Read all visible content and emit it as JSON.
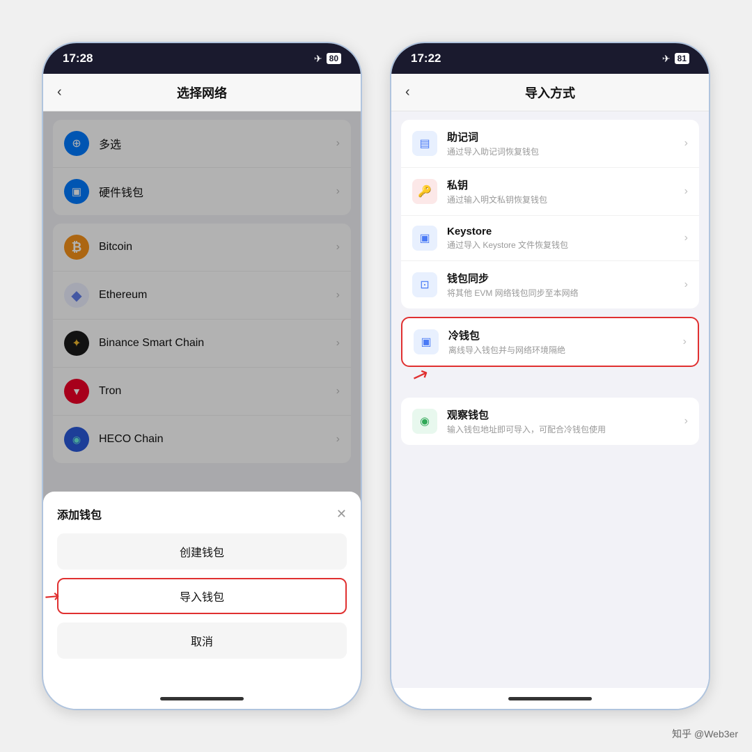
{
  "phone_left": {
    "status_time": "17:28",
    "battery": "80",
    "nav_title": "选择网络",
    "networks": [
      {
        "name": "多选",
        "icon_type": "multiselect",
        "icon_char": "⊕"
      },
      {
        "name": "硬件钱包",
        "icon_type": "hardware",
        "icon_char": "▣"
      },
      {
        "name": "Bitcoin",
        "icon_type": "btc",
        "icon_char": "₿"
      },
      {
        "name": "Ethereum",
        "icon_type": "eth",
        "icon_char": "◆"
      },
      {
        "name": "Binance Smart Chain",
        "icon_type": "bsc",
        "icon_char": "✦"
      },
      {
        "name": "Tron",
        "icon_type": "trx",
        "icon_char": "▼"
      },
      {
        "name": "HECO Chain",
        "icon_type": "heco",
        "icon_char": "◉"
      }
    ],
    "sheet_title": "添加钱包",
    "sheet_create": "创建钱包",
    "sheet_import": "导入钱包",
    "sheet_cancel": "取消"
  },
  "phone_right": {
    "status_time": "17:22",
    "battery": "81",
    "nav_title": "导入方式",
    "import_items": [
      {
        "title": "助记词",
        "desc": "通过导入助记词恢复钱包",
        "icon_char": "▤",
        "highlighted": false
      },
      {
        "title": "私钥",
        "desc": "通过输入明文私钥恢复钱包",
        "icon_char": "🔑",
        "highlighted": false
      },
      {
        "title": "Keystore",
        "desc": "通过导入 Keystore 文件恢复钱包",
        "icon_char": "▣",
        "highlighted": false
      },
      {
        "title": "钱包同步",
        "desc": "将其他 EVM 网络钱包同步至本网络",
        "icon_char": "⊡",
        "highlighted": false
      }
    ],
    "cold_wallet": {
      "title": "冷钱包",
      "desc": "离线导入钱包并与网络环境隔绝",
      "icon_char": "▣",
      "highlighted": true
    },
    "watch_wallet": {
      "title": "观察钱包",
      "desc": "输入钱包地址即可导入，可配合冷钱包使用",
      "icon_char": "◉",
      "highlighted": false
    }
  },
  "watermark": "知乎 @Web3er"
}
